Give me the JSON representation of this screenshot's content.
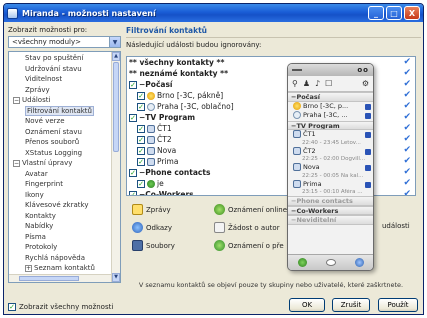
{
  "window": {
    "title": "Miranda - možnosti nastavení",
    "controls": [
      "_",
      "□",
      "X"
    ]
  },
  "left": {
    "show_label": "Zobrazit možnosti pro:",
    "filter_value": "<všechny moduly>",
    "tree": [
      {
        "label": "Stav po spuštění",
        "indent": 2
      },
      {
        "label": "Udržování stavu",
        "indent": 2
      },
      {
        "label": "Viditelnost",
        "indent": 2
      },
      {
        "label": "Zprávy",
        "indent": 2
      },
      {
        "label": "Události",
        "indent": 1,
        "toggle": "−"
      },
      {
        "label": "Filtrování kontaktů",
        "indent": 2,
        "selected": true
      },
      {
        "label": "Nové verze",
        "indent": 2
      },
      {
        "label": "Oznámení stavu",
        "indent": 2
      },
      {
        "label": "Přenos souborů",
        "indent": 2
      },
      {
        "label": "XStatus Logging",
        "indent": 2
      },
      {
        "label": "Vlastní úpravy",
        "indent": 1,
        "toggle": "−"
      },
      {
        "label": "Avatar",
        "indent": 2
      },
      {
        "label": "Fingerprint",
        "indent": 2
      },
      {
        "label": "Ikony",
        "indent": 2
      },
      {
        "label": "Klávesové zkratky",
        "indent": 2
      },
      {
        "label": "Kontakty",
        "indent": 2
      },
      {
        "label": "Nabídky",
        "indent": 2
      },
      {
        "label": "Písma",
        "indent": 2
      },
      {
        "label": "Protokoly",
        "indent": 2
      },
      {
        "label": "Rychlá nápověda",
        "indent": 2
      },
      {
        "label": "Seznam kontaktů",
        "indent": 2,
        "toggle": "+"
      }
    ],
    "show_all_label": "Zobrazit všechny možnosti"
  },
  "right": {
    "section_title": "Filtrování kontaktů",
    "instruction": "Následující události budou ignorovány:",
    "contacts": [
      {
        "label": "** všechny kontakty **",
        "bold": true,
        "indent": 0
      },
      {
        "label": "** neznámé kontakty **",
        "bold": true,
        "indent": 0
      },
      {
        "label": "Počasí",
        "bold": true,
        "indent": 0,
        "group": true
      },
      {
        "label": "Brno  [-3C, pákně]",
        "indent": 1,
        "icon": "sun"
      },
      {
        "label": "Praha  [-3C, oblačno]",
        "indent": 1,
        "icon": "cloud"
      },
      {
        "label": "TV Program",
        "bold": true,
        "indent": 0,
        "group": true
      },
      {
        "label": "ČT1",
        "indent": 1,
        "icon": "tv"
      },
      {
        "label": "ČT2",
        "indent": 1,
        "icon": "tv"
      },
      {
        "label": "Nova",
        "indent": 1,
        "icon": "tv"
      },
      {
        "label": "Prima",
        "indent": 1,
        "icon": "tv"
      },
      {
        "label": "Phone contacts",
        "bold": true,
        "indent": 0,
        "group": true
      },
      {
        "label": "je",
        "indent": 1,
        "icon": "clover"
      },
      {
        "label": "Co-Workers",
        "bold": true,
        "indent": 0,
        "group": true
      }
    ],
    "events": {
      "messages": "Zprávy",
      "links": "Odkazy",
      "files": "Soubory",
      "notify_online": "Oznámení online",
      "auth_request": "Žádost o autor",
      "notify_other": "Oznámení o pře",
      "other_suffix": "události"
    },
    "footnote": "V seznamu kontaktů se objeví pouze ty skupiny nebo uživatelé, které zaškrtnete.",
    "buttons": {
      "ok": "OK",
      "cancel": "Zrušit",
      "apply": "Použít"
    }
  },
  "popup": {
    "toolbar_icons": [
      "search-icon",
      "user-icon",
      "music-icon",
      "chat-icon",
      "settings-icon"
    ],
    "rows": [
      {
        "type": "group",
        "label": "Počasí"
      },
      {
        "type": "contact",
        "label": "Brno  [-3C, p...",
        "icon": "sun"
      },
      {
        "type": "contact",
        "label": "Praha  [-3C, ...",
        "icon": "cloud"
      },
      {
        "type": "group",
        "label": "TV Program"
      },
      {
        "type": "contact",
        "label": "ČT1",
        "icon": "tv",
        "sub": "22:40 - 23:45 Letov..."
      },
      {
        "type": "contact",
        "label": "ČT2",
        "icon": "tv",
        "sub": "22:25 - 02:00 Dogvill..."
      },
      {
        "type": "contact",
        "label": "Nova",
        "icon": "tv",
        "sub": "22:25 - 00:05 Na kal..."
      },
      {
        "type": "contact",
        "label": "Prima",
        "icon": "tv",
        "sub": "23:15 - 00:10 Aféra ..."
      },
      {
        "type": "group",
        "label": "Phone contacts",
        "dim": true
      },
      {
        "type": "group",
        "label": "Co-Workers"
      },
      {
        "type": "group",
        "label": "Neviditelní",
        "dim": true
      }
    ]
  },
  "colors": {
    "title_blue": "#1a5dd6",
    "section_blue": "#1f58a6",
    "window_bg": "#ece9d8",
    "check_blue": "#2f6fd6"
  }
}
